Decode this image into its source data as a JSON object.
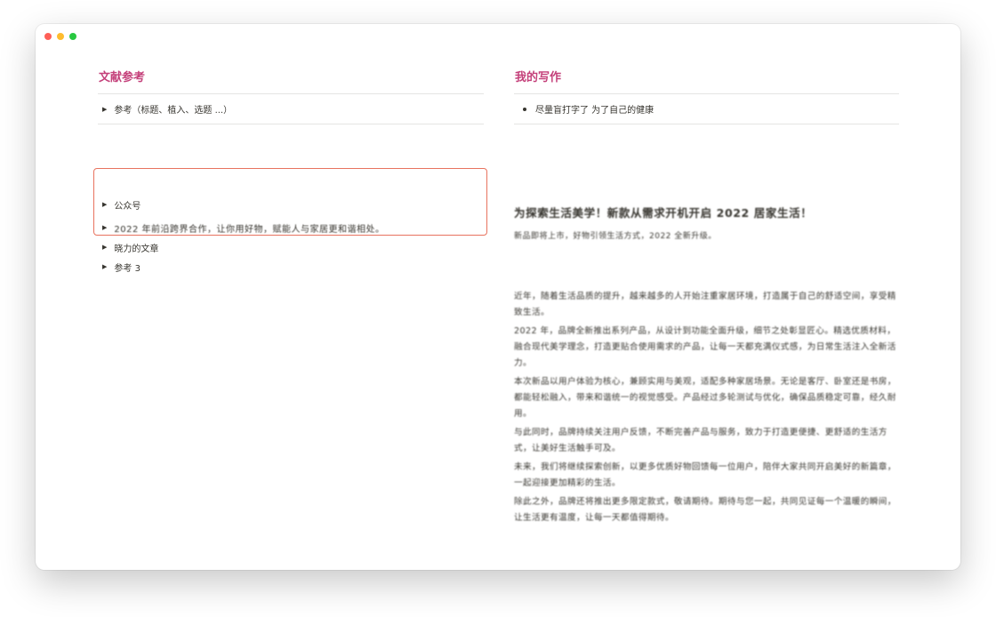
{
  "left": {
    "heading": "文献参考",
    "ref_row": "参考（标题、植入、选题 ...）",
    "toggles": [
      "公众号",
      "2022 年前沿跨界合作，让你用好物，赋能人与家居更和谐相处。",
      "晓力的文章",
      "参考 3"
    ]
  },
  "right": {
    "heading": "我的写作",
    "bullet": "尽量盲打字了 为了自己的健康",
    "article": {
      "title": "为探索生活美学！新款从需求开机开启 2022 居家生活！",
      "subtitle": "新品即将上市，好物引领生活方式，2022 全新升级。",
      "paragraphs": [
        "近年，随着生活品质的提升，越来越多的人开始注重家居环境，打造属于自己的舒适空间，享受精致生活。",
        "2022 年，品牌全新推出系列产品，从设计到功能全面升级，细节之处彰显匠心。精选优质材料，融合现代美学理念，打造更贴合使用需求的产品，让每一天都充满仪式感，为日常生活注入全新活力。",
        "本次新品以用户体验为核心，兼顾实用与美观，适配多种家居场景。无论是客厅、卧室还是书房，都能轻松融入，带来和谐统一的视觉感受。产品经过多轮测试与优化，确保品质稳定可靠，经久耐用。",
        "与此同时，品牌持续关注用户反馈，不断完善产品与服务，致力于打造更便捷、更舒适的生活方式，让美好生活触手可及。",
        "未来，我们将继续探索创新，以更多优质好物回馈每一位用户，陪伴大家共同开启美好的新篇章，一起迎接更加精彩的生活。",
        "除此之外，品牌还将推出更多限定款式，敬请期待。期待与您一起，共同见证每一个温暖的瞬间，让生活更有温度，让每一天都值得期待。"
      ]
    }
  }
}
